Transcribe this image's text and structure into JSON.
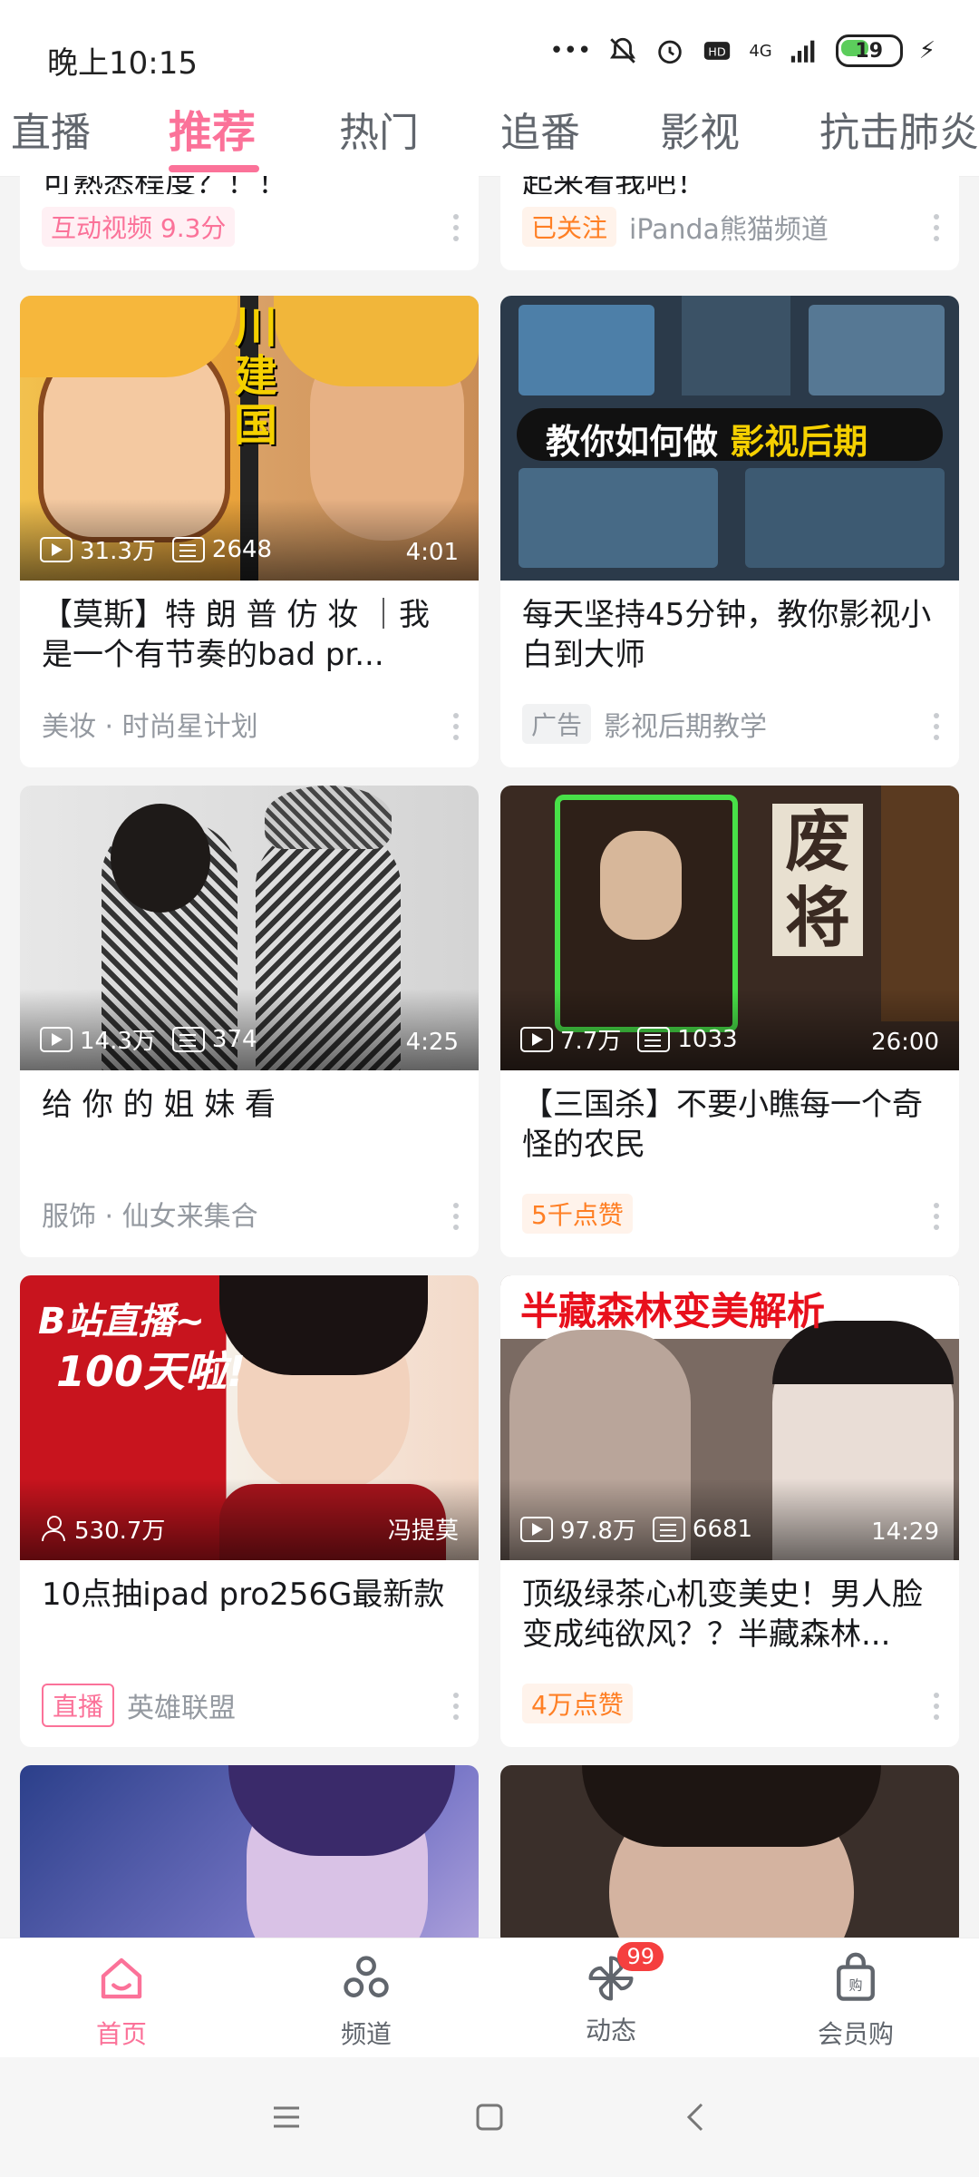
{
  "status_bar": {
    "time": "晚上10:15",
    "battery": "19",
    "network": "4G"
  },
  "tabs": [
    {
      "label": "直播"
    },
    {
      "label": "推荐"
    },
    {
      "label": "热门"
    },
    {
      "label": "追番"
    },
    {
      "label": "影视"
    },
    {
      "label": "抗击肺炎"
    }
  ],
  "feed": {
    "partial": [
      {
        "title_fragment": "可熟悉程度？！！",
        "badge": "互动视频 9.3分"
      },
      {
        "title_fragment": "起来看我吧！",
        "badge": "已关注",
        "meta": "iPanda熊猫频道"
      }
    ],
    "cards": [
      {
        "thumb_overlay": "川建国",
        "views": "31.3万",
        "danmaku": "2648",
        "duration": "4:01",
        "title": "【莫斯】特 朗 普 仿 妆 ｜我是一个有节奏的bad pr...",
        "meta": "美妆 · 时尚星计划"
      },
      {
        "thumb_overlay_prefix": "教你如何做",
        "thumb_overlay_highlight": "影视后期",
        "title": "每天坚持45分钟，教你影视小白到大师",
        "badge": "广告",
        "meta": "影视后期教学"
      },
      {
        "views": "14.3万",
        "danmaku": "374",
        "duration": "4:25",
        "title": "给 你 的 姐 妹 看",
        "meta": "服饰 · 仙女来集合"
      },
      {
        "thumb_overlay": "废将",
        "views": "7.7万",
        "danmaku": "1033",
        "duration": "26:00",
        "title": "【三国杀】不要小瞧每一个奇怪的农民",
        "badge": "5千点赞"
      },
      {
        "thumb_overlay_line1": "B站直播~",
        "thumb_overlay_line2": "100天啦!",
        "live_viewers": "530.7万",
        "anchor": "冯提莫",
        "title": "10点抽ipad pro256G最新款",
        "badge": "直播",
        "meta": "英雄联盟"
      },
      {
        "thumb_overlay": "半藏森林变美解析",
        "views": "97.8万",
        "danmaku": "6681",
        "duration": "14:29",
        "title": "顶级绿茶心机变美史！男人脸变成纯欲风？？半藏森林...",
        "badge": "4万点赞"
      }
    ]
  },
  "bottom_nav": [
    {
      "label": "首页",
      "icon": "home-icon"
    },
    {
      "label": "频道",
      "icon": "channel-icon"
    },
    {
      "label": "动态",
      "icon": "dynamic-icon",
      "badge": "99"
    },
    {
      "label": "会员购",
      "icon": "shopping-bag-icon"
    }
  ],
  "colors": {
    "accent": "#fb7299",
    "orange": "#ff7f24"
  }
}
